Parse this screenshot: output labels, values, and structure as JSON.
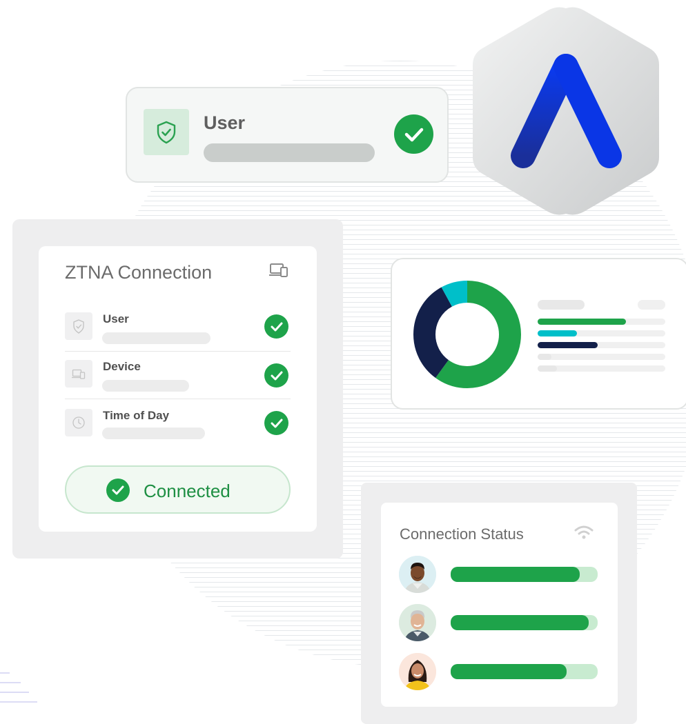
{
  "user_card": {
    "title": "User"
  },
  "ztna": {
    "title": "ZTNA Connection",
    "rows": [
      {
        "label": "User",
        "icon": "shield-icon"
      },
      {
        "label": "Device",
        "icon": "devices-icon"
      },
      {
        "label": "Time of Day",
        "icon": "clock-icon"
      }
    ],
    "status_label": "Connected"
  },
  "donut": {
    "segments": [
      {
        "color": "#1ea34a",
        "fraction": 0.6
      },
      {
        "color": "#13204a",
        "fraction": 0.32
      },
      {
        "color": "#00bfc9",
        "fraction": 0.08
      }
    ],
    "legend_bars": [
      {
        "color": "#1ea34a",
        "fraction": 0.69
      },
      {
        "color": "#00bfc9",
        "fraction": 0.31
      },
      {
        "color": "#13204a",
        "fraction": 0.47
      },
      {
        "color": "#e7e7e7",
        "fraction": 0.11
      },
      {
        "color": "#e7e7e7",
        "fraction": 0.15
      }
    ]
  },
  "connection_status": {
    "title": "Connection Status",
    "users": [
      {
        "avatar": "avatar-man-1",
        "level": 0.88
      },
      {
        "avatar": "avatar-man-2",
        "level": 0.94
      },
      {
        "avatar": "avatar-woman",
        "level": 0.79
      }
    ]
  },
  "colors": {
    "accent_green": "#1ea34a",
    "brand_blue": "#0a36e6",
    "navy": "#13204a",
    "teal": "#00bfc9"
  }
}
